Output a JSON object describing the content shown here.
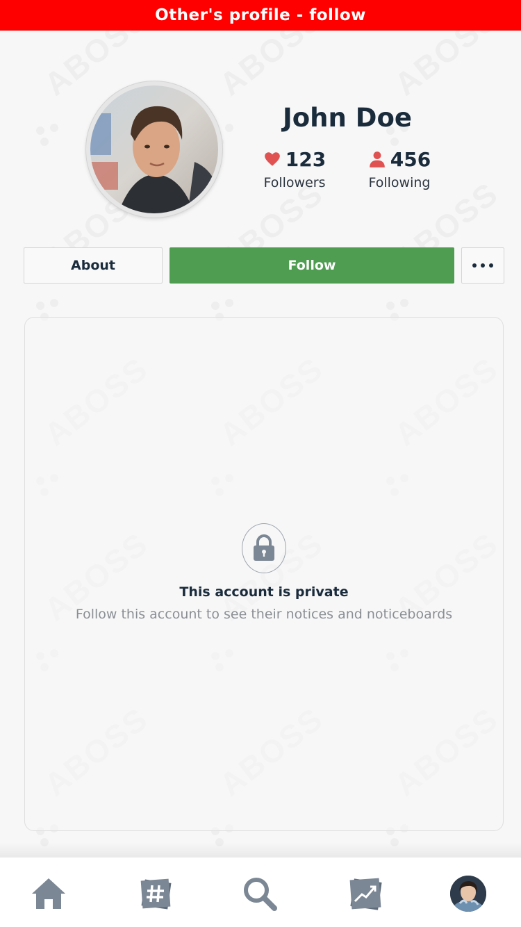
{
  "header": {
    "title": "Other's profile - follow",
    "background": "#ff0000"
  },
  "profile": {
    "name": "John Doe",
    "followers": {
      "count": "123",
      "label": "Followers",
      "icon": "heart-icon"
    },
    "following": {
      "count": "456",
      "label": "Following",
      "icon": "person-icon"
    }
  },
  "actions": {
    "about_label": "About",
    "follow_label": "Follow",
    "more_icon": "more-dots-icon"
  },
  "private_notice": {
    "icon": "lock-icon",
    "title": "This account is private",
    "subtitle": "Follow this account to see their notices and noticeboards"
  },
  "watermark": {
    "text": "ABOSS"
  },
  "tabbar": {
    "items": [
      {
        "name": "home",
        "icon": "home-icon"
      },
      {
        "name": "hashtag",
        "icon": "hashtag-icon"
      },
      {
        "name": "search",
        "icon": "search-icon"
      },
      {
        "name": "trending",
        "icon": "trending-icon"
      },
      {
        "name": "profile",
        "icon": "avatar"
      }
    ]
  },
  "colors": {
    "accent_follow": "#4f9d50",
    "icon_red": "#e05252",
    "text_dark": "#1a2b3c",
    "text_muted": "#8a8f95",
    "tab_icon": "#7b8794"
  }
}
